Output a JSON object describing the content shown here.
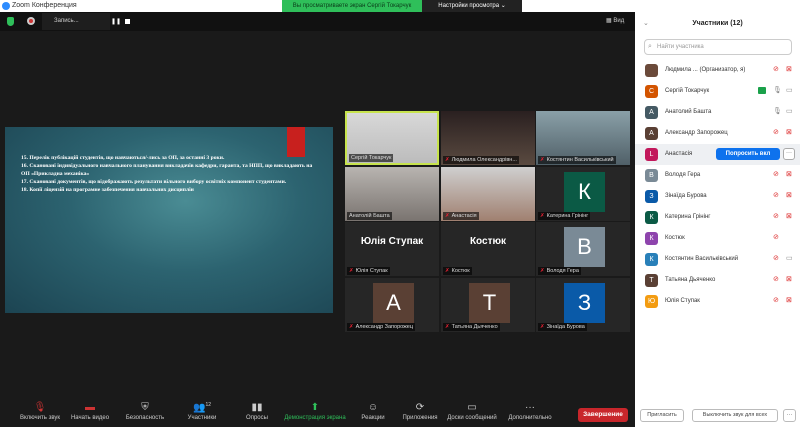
{
  "titlebar": {
    "title": "Zoom Конференция",
    "share_banner": "Вы просматриваете экран Сергій Токарчук",
    "view_options": "Настройки просмотра ⌄"
  },
  "topbar": {
    "recording_label": "Запись...",
    "pause": "❚❚",
    "view": "Вид"
  },
  "slide": {
    "lines": [
      "15. Перелік публікацій студентів, що навчаються/-лись за ОП, за останні 3 роки.",
      "16. Скановані індивідуального навчального планування викладачів кафедри, гаранта, та НПП, що викладають на ОП «Прикладна механіка»",
      "17. Скановані документів, що відображають результати вільного вибору освітніх компонент студентами.",
      "18. Копії ліцензій на програмне забезпечення навчальних дисциплін"
    ]
  },
  "grid": [
    {
      "name": "Сергій Токарчук",
      "muted": false,
      "active": true,
      "video": true
    },
    {
      "name": "Людмила Олександрівн...",
      "muted": true,
      "video": true
    },
    {
      "name": "Костянтин Васильківський",
      "muted": true,
      "video": true
    },
    {
      "name": "Анатолій Башта",
      "muted": false,
      "video": true
    },
    {
      "name": "Анастасія",
      "muted": true,
      "video": true
    },
    {
      "name": "Катерина Грінінг",
      "muted": true,
      "initial": "К",
      "color": "#0b5a45"
    },
    {
      "name": "Юлія Ступак",
      "muted": true,
      "big": "Юлія Ступак"
    },
    {
      "name": "Костюк",
      "muted": true,
      "big": "Костюк"
    },
    {
      "name": "Володя Гера",
      "muted": true,
      "initial": "В",
      "color": "#7a8a96"
    },
    {
      "name": "Александр Запорожец",
      "muted": true,
      "initial": "А",
      "color": "#5a4034"
    },
    {
      "name": "Татьяна Дьяченко",
      "muted": true,
      "initial": "Т",
      "color": "#5a4034"
    },
    {
      "name": "Зінаїда Бурова",
      "muted": true,
      "initial": "З",
      "color": "#0a5aa8"
    }
  ],
  "toolbar": {
    "unmute": "Включить звук",
    "start_video": "Начать видео",
    "security": "Безопасность",
    "participants": "Участники",
    "participants_count": "12",
    "polls": "Опросы",
    "share_screen": "Демонстрация экрана",
    "reactions": "Реакции",
    "apps": "Приложения",
    "whiteboards": "Доски сообщений",
    "more": "Дополнительно",
    "end": "Завершение"
  },
  "panel": {
    "title": "Участники (12)",
    "search_placeholder": "Найти участника",
    "ask_unmute": "Попросить вкл",
    "more": "···",
    "participants": [
      {
        "initial": "",
        "name": "Людмила ...  (Организатор, я)",
        "color": "#6b4a3a",
        "mic": "muted",
        "cam": "off"
      },
      {
        "initial": "С",
        "name": "Сергій Токарчук",
        "color": "#d35400",
        "mic": "on",
        "cam": "on",
        "sharing": true
      },
      {
        "initial": "А",
        "name": "Анатолий Башта",
        "color": "#455a64",
        "mic": "on",
        "cam": "on"
      },
      {
        "initial": "А",
        "name": "Александр Запорожец",
        "color": "#5a4034",
        "mic": "muted",
        "cam": "off"
      },
      {
        "initial": "L",
        "name": "Анастасія",
        "color": "#c2185b",
        "highlight": true
      },
      {
        "initial": "В",
        "name": "Володя Гера",
        "color": "#7a8a96",
        "mic": "muted",
        "cam": "off"
      },
      {
        "initial": "З",
        "name": "Зінаїда Бурова",
        "color": "#0a5aa8",
        "mic": "muted",
        "cam": "off"
      },
      {
        "initial": "К",
        "name": "Катерина Грінінг",
        "color": "#0b5a45",
        "mic": "muted",
        "cam": "off"
      },
      {
        "initial": "К",
        "name": "Костюк",
        "color": "#8e44ad",
        "mic": "muted"
      },
      {
        "initial": "К",
        "name": "Костянтин Васильківський",
        "color": "#2980b9",
        "mic": "muted",
        "cam": "on"
      },
      {
        "initial": "Т",
        "name": "Татьяна Дьяченко",
        "color": "#5a4034",
        "mic": "muted",
        "cam": "off"
      },
      {
        "initial": "Ю",
        "name": "Юлія Ступак",
        "color": "#f39c12",
        "mic": "muted",
        "cam": "off"
      }
    ],
    "invite": "Пригласить",
    "mute_all": "Выключить звук для всех"
  }
}
